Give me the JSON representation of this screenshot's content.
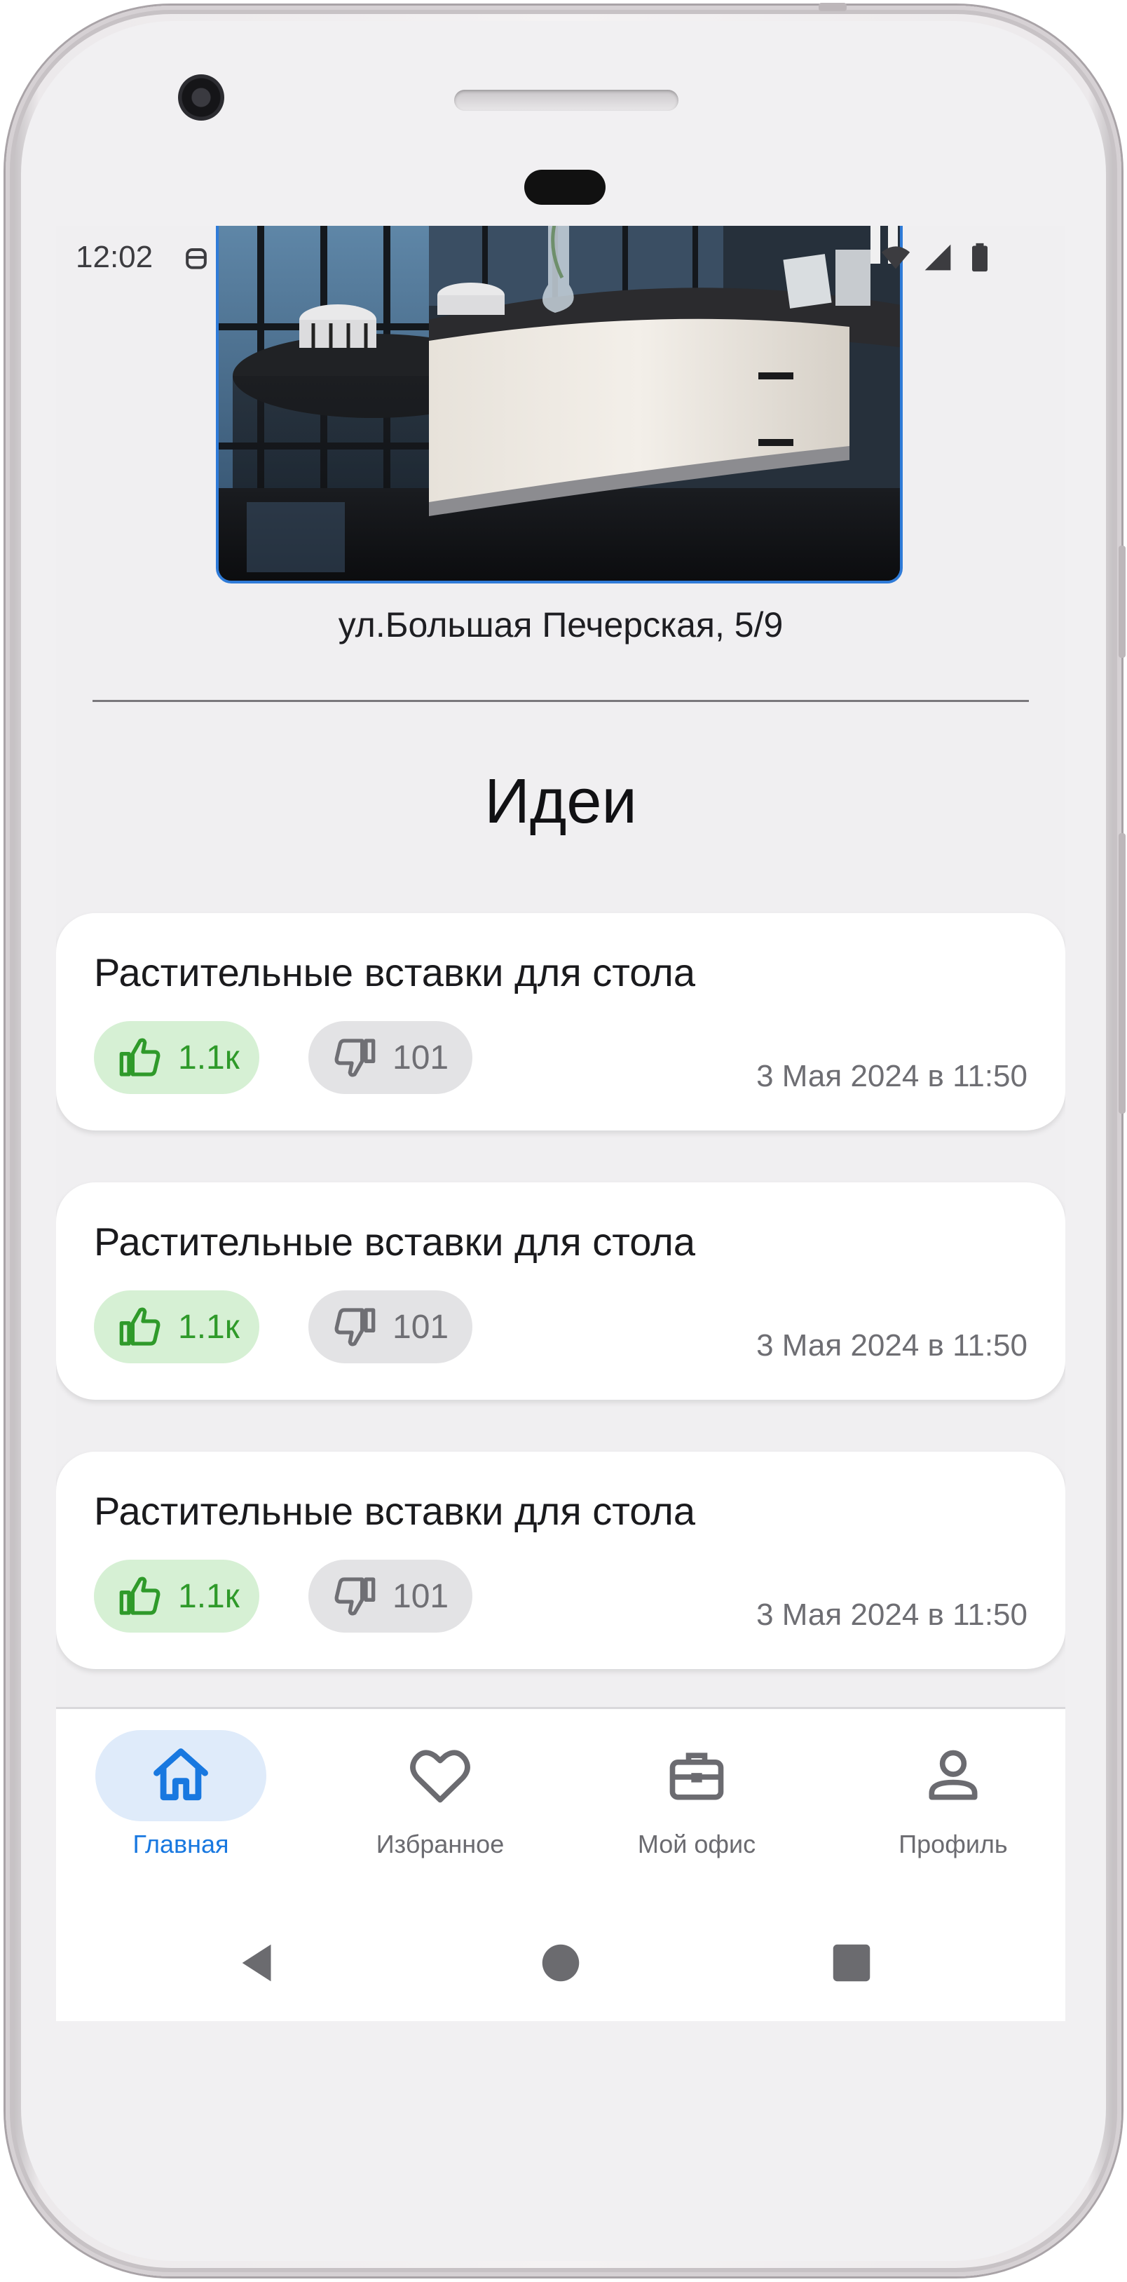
{
  "status_bar": {
    "time": "12:02",
    "icons": [
      "debug-icon",
      "wifi-icon",
      "signal-icon",
      "battery-icon"
    ]
  },
  "office": {
    "photo": "office-reception-desk-photo",
    "address": "ул.Большая Печерская, 5/9"
  },
  "ideas": {
    "title": "Идеи",
    "items": [
      {
        "title": "Растительные вставки для стола",
        "likes": "1.1к",
        "dislikes": "101",
        "date": "3 Мая 2024 в 11:50"
      },
      {
        "title": "Растительные вставки для стола",
        "likes": "1.1к",
        "dislikes": "101",
        "date": "3 Мая 2024 в 11:50"
      },
      {
        "title": "Растительные вставки для стола",
        "likes": "1.1к",
        "dislikes": "101",
        "date": "3 Мая 2024 в 11:50"
      }
    ]
  },
  "bottom_nav": {
    "items": [
      {
        "label": "Главная",
        "icon": "home-icon",
        "active": true
      },
      {
        "label": "Избранное",
        "icon": "heart-icon",
        "active": false
      },
      {
        "label": "Мой офис",
        "icon": "briefcase-icon",
        "active": false
      },
      {
        "label": "Профиль",
        "icon": "person-icon",
        "active": false
      }
    ]
  },
  "system_nav": [
    "back-icon",
    "home-circle-icon",
    "recents-icon"
  ],
  "colors": {
    "accent": "#1878e0",
    "like_bg": "#d6f0d4",
    "like_fg": "#2f9a2a",
    "dislike_bg": "#e3e3e5",
    "screen_bg": "#f0eff1"
  }
}
